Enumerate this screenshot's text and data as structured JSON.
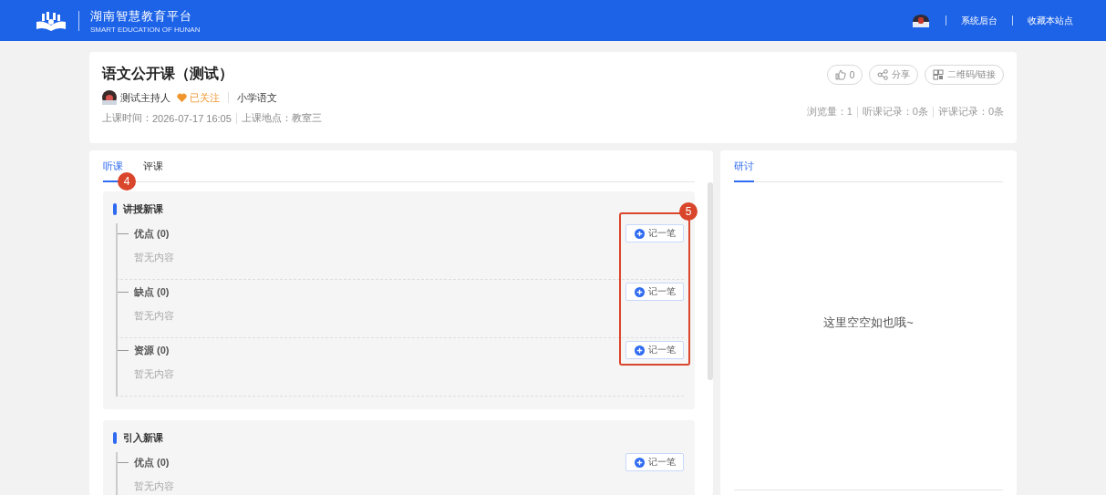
{
  "header": {
    "title": "湖南智慧教育平台",
    "subtitle": "SMART EDUCATION OF HUNAN",
    "links": [
      "系统后台",
      "收藏本站点"
    ]
  },
  "lesson": {
    "title": "语文公开课（测试）",
    "host": "测试主持人",
    "follow": "已关注",
    "followed": true,
    "subject": "小学语文",
    "time_label": "上课时间：",
    "time": "2026-07-17 16:05",
    "place_label": "上课地点：",
    "place": "教室三",
    "actions": [
      {
        "kind": "like",
        "label": "0"
      },
      {
        "kind": "share",
        "label": "分享"
      },
      {
        "kind": "qr",
        "label": "二维码/链接"
      }
    ],
    "stats": [
      "浏览量：1",
      "听课记录：0条",
      "评课记录：0条"
    ]
  },
  "left_tabs": [
    {
      "label": "听课",
      "selected": true,
      "annotation": "4"
    },
    {
      "label": "评课",
      "selected": false
    }
  ],
  "sections": [
    {
      "title": "讲授新课",
      "annotation": "5",
      "items": [
        {
          "label": "优点 (0)",
          "empty": "暂无内容",
          "button": "记一笔"
        },
        {
          "label": "缺点 (0)",
          "empty": "暂无内容",
          "button": "记一笔"
        },
        {
          "label": "资源 (0)",
          "empty": "暂无内容",
          "button": "记一笔"
        }
      ]
    },
    {
      "title": "引入新课",
      "items": [
        {
          "label": "优点 (0)",
          "empty": "暂无内容",
          "button": "记一笔"
        }
      ]
    }
  ],
  "right_tabs": [
    {
      "label": "研讨",
      "selected": true
    }
  ],
  "right_empty": "这里空空如也哦~"
}
